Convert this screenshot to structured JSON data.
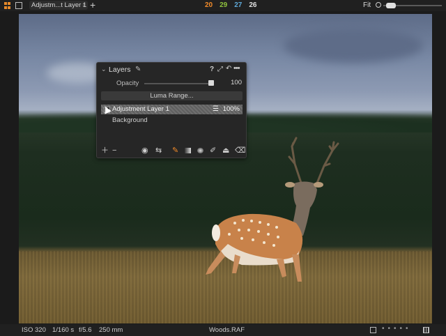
{
  "topbar": {
    "layer_select": "Adjustm...t Layer 1",
    "counts": [
      "20",
      "29",
      "27",
      "26"
    ],
    "zoom_label": "Fit"
  },
  "panel": {
    "title": "Layers",
    "help": "?",
    "opacity_label": "Opacity",
    "opacity_value": "100",
    "luma_button": "Luma Range...",
    "layers": [
      {
        "name": "Adjustment Layer 1",
        "opacity": "100%",
        "selected": true
      },
      {
        "name": "Background",
        "opacity": "",
        "selected": false
      }
    ]
  },
  "bottombar": {
    "iso": "ISO 320",
    "shutter": "1/160 s",
    "aperture": "f/5.6",
    "focal": "250 mm",
    "file": "Woods.RAF"
  },
  "colors": {
    "accent": "#f08a2a",
    "count_red": "#f08a2a",
    "count_green": "#8fc23e",
    "count_blue": "#5fa9d8"
  }
}
